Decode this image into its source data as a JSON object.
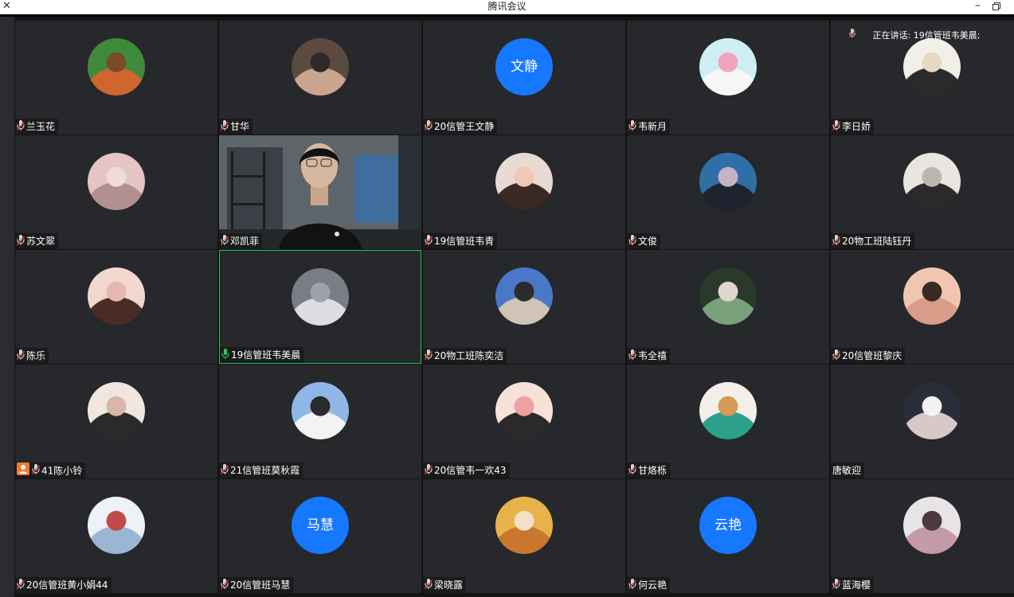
{
  "window": {
    "title": "腾讯会议",
    "close_icon": "close-icon",
    "minimize_icon": "minimize-icon",
    "restore_icon": "restore-icon"
  },
  "speaking_indicator": {
    "prefix": "正在讲话:",
    "name": "19信管班韦美晨;"
  },
  "tiles": [
    {
      "name": "兰玉花",
      "avatar": {
        "type": "photo",
        "colors": [
          "#3f8a3a",
          "#d06530",
          "#7a4a2a"
        ]
      }
    },
    {
      "name": "甘华",
      "avatar": {
        "type": "photo",
        "colors": [
          "#5a4a40",
          "#c9a590",
          "#2f2a27"
        ]
      }
    },
    {
      "name": "20信管王文静",
      "avatar": {
        "type": "text",
        "text": "文静",
        "color": "#1677ff"
      }
    },
    {
      "name": "韦新月",
      "avatar": {
        "type": "photo",
        "colors": [
          "#cfeef3",
          "#f6f6f6",
          "#f2a3bf"
        ]
      }
    },
    {
      "name": "李日娇",
      "avatar": {
        "type": "photo",
        "colors": [
          "#f2efe9",
          "#2a2a2a",
          "#e7d7c0"
        ]
      }
    },
    {
      "name": "苏文翠",
      "avatar": {
        "type": "photo",
        "colors": [
          "#e5c4c4",
          "#b39090",
          "#f1dcd5"
        ]
      }
    },
    {
      "name": "邓凯菲",
      "avatar": {
        "type": "video"
      }
    },
    {
      "name": "19信管班韦青",
      "avatar": {
        "type": "photo",
        "colors": [
          "#e8d9d2",
          "#3b2a24",
          "#f0c8b8"
        ]
      }
    },
    {
      "name": "文俊",
      "avatar": {
        "type": "photo",
        "colors": [
          "#2f6fa6",
          "#1f2330",
          "#c6b3c6"
        ]
      }
    },
    {
      "name": "20物工班陆钰丹",
      "avatar": {
        "type": "photo",
        "colors": [
          "#e9e6e2",
          "#2a2a2a",
          "#bbb6b0"
        ]
      }
    },
    {
      "name": "陈乐",
      "avatar": {
        "type": "photo",
        "colors": [
          "#f1d7ce",
          "#4a2c25",
          "#e6b7ae"
        ]
      }
    },
    {
      "name": "19信管班韦美晨",
      "avatar": {
        "type": "photo",
        "colors": [
          "#7a7d86",
          "#dcdde2",
          "#9fa2ab"
        ]
      },
      "active": true,
      "mic_on": true
    },
    {
      "name": "20物工班陈奕洁",
      "avatar": {
        "type": "photo",
        "colors": [
          "#4a77c7",
          "#cfc4b5",
          "#2b2b2b"
        ]
      }
    },
    {
      "name": "韦全禧",
      "avatar": {
        "type": "photo",
        "colors": [
          "#2a3a2a",
          "#7aa27a",
          "#e0d6d0"
        ]
      }
    },
    {
      "name": "20信管班黎庆",
      "avatar": {
        "type": "photo",
        "colors": [
          "#f0c6b0",
          "#d89c88",
          "#3a2a24"
        ]
      }
    },
    {
      "name": "41陈小铃",
      "avatar": {
        "type": "photo",
        "colors": [
          "#f0e6e0",
          "#2a2a2a",
          "#d8b7a8"
        ]
      },
      "person_badge": true
    },
    {
      "name": "21信管班莫秋霞",
      "avatar": {
        "type": "photo",
        "colors": [
          "#8fb6e6",
          "#f3f3f3",
          "#2a2a2a"
        ]
      }
    },
    {
      "name": "20信管韦一欢43",
      "avatar": {
        "type": "photo",
        "colors": [
          "#f6e2d8",
          "#2a2a2a",
          "#f0a0a0"
        ]
      }
    },
    {
      "name": "甘烙栎",
      "avatar": {
        "type": "photo",
        "colors": [
          "#f3efe8",
          "#2ca08a",
          "#d59a55"
        ]
      }
    },
    {
      "name": "唐敏迎",
      "avatar": {
        "type": "photo",
        "colors": [
          "#2a2d3a",
          "#d8c8c8",
          "#f2f2f2"
        ]
      },
      "no_mic": true
    },
    {
      "name": "20信管班黄小娟44",
      "avatar": {
        "type": "photo",
        "colors": [
          "#eef2f6",
          "#9bb6d3",
          "#c24a4a"
        ]
      }
    },
    {
      "name": "20信管班马慧",
      "avatar": {
        "type": "text",
        "text": "马慧",
        "color": "#1677ff"
      }
    },
    {
      "name": "梁晓露",
      "avatar": {
        "type": "photo",
        "colors": [
          "#e7b24a",
          "#c9762f",
          "#f3e0c9"
        ]
      }
    },
    {
      "name": "何云艳",
      "avatar": {
        "type": "text",
        "text": "云艳",
        "color": "#1677ff"
      }
    },
    {
      "name": "蓝海樱",
      "avatar": {
        "type": "photo",
        "colors": [
          "#e8e3e6",
          "#c49aa9",
          "#4a3a40"
        ]
      }
    }
  ]
}
